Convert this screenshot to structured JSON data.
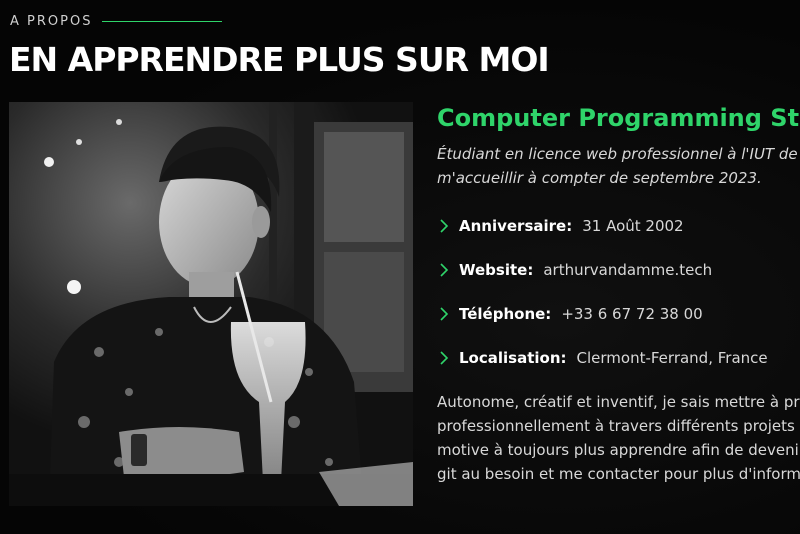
{
  "section": {
    "eyebrow": "A PROPOS",
    "title": "EN APPRENDRE PLUS SUR MOI"
  },
  "profile": {
    "job_title": "Computer Programming Stud",
    "intro_lines": [
      "Étudiant en licence web professionnel à l'IUT de Cler",
      "m'accueillir à compter de septembre 2023."
    ],
    "info": [
      {
        "label": "Anniversaire:",
        "value": "31 Août 2002",
        "icon": "chevron-right-icon"
      },
      {
        "label": "Website:",
        "value": "arthurvandamme.tech",
        "icon": "chevron-right-icon"
      },
      {
        "label": "Téléphone:",
        "value": "+33 6 67 72 38 00",
        "icon": "chevron-right-icon"
      },
      {
        "label": "Localisation:",
        "value": "Clermont-Ferrand, France",
        "icon": "chevron-right-icon"
      }
    ],
    "bio_lines": [
      "Autonome, créatif et inventif, je sais mettre à pro",
      "professionnellement à travers différents projets v",
      "motive à toujours plus apprendre afin de devenir",
      "git au besoin et me contacter pour plus d'informa"
    ]
  },
  "colors": {
    "accent": "#2fd46a",
    "background": "#050505",
    "text": "#d8d8d8"
  }
}
